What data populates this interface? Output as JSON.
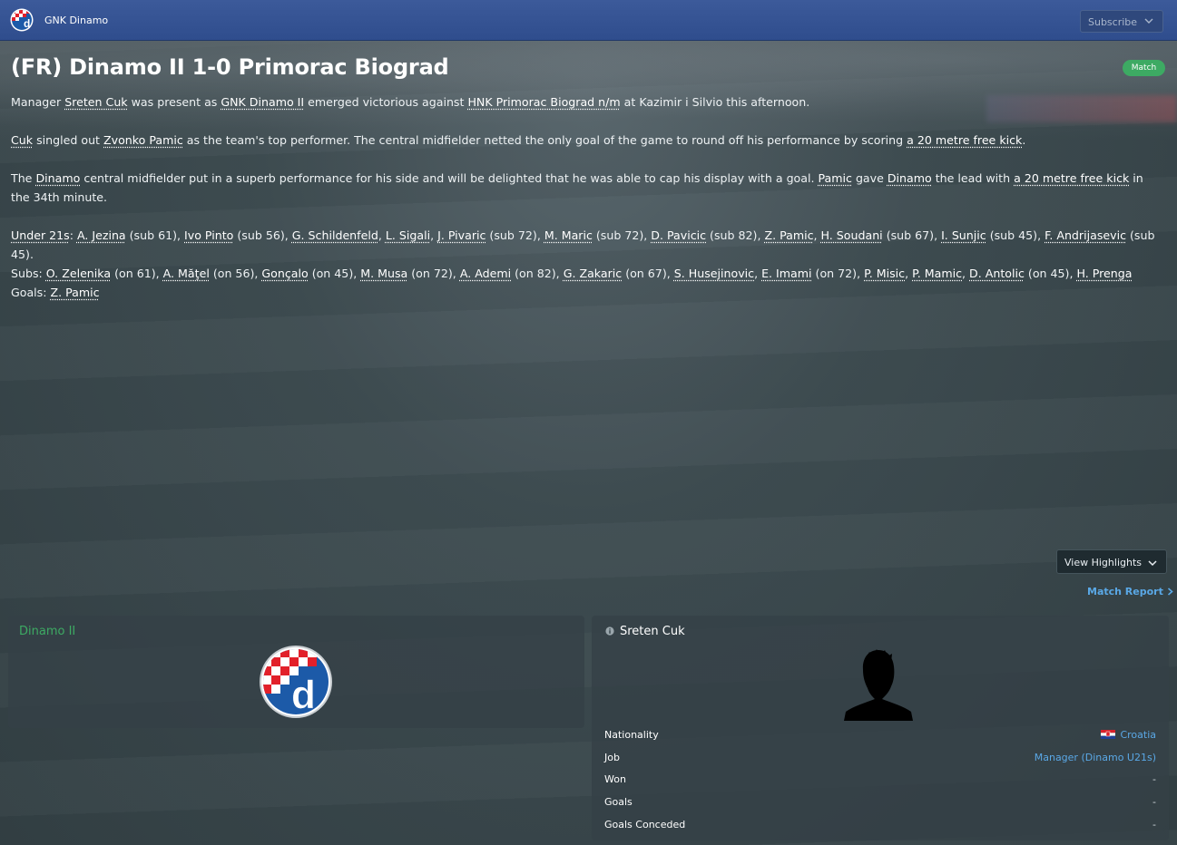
{
  "topbar": {
    "club_name": "GNK Dinamo",
    "subscribe_label": "Subscribe"
  },
  "headline": "(FR) Dinamo II 1-0 Primorac Biograd",
  "badge": "Match",
  "article": {
    "p1": [
      {
        "t": "Manager "
      },
      {
        "t": "Sreten Cuk",
        "link": true
      },
      {
        "t": " was present as "
      },
      {
        "t": "GNK Dinamo II",
        "link": true
      },
      {
        "t": " emerged victorious against "
      },
      {
        "t": "HNK Primorac Biograd n/m",
        "link": true
      },
      {
        "t": " at Kazimir i Silvio this afternoon."
      }
    ],
    "p2": [
      {
        "t": "Cuk",
        "link": true
      },
      {
        "t": " singled out "
      },
      {
        "t": "Zvonko Pamic",
        "link": true
      },
      {
        "t": " as the team's top performer. The central midfielder netted the only goal of the game to round off his performance by scoring "
      },
      {
        "t": "a 20 metre free kick",
        "link": true
      },
      {
        "t": "."
      }
    ],
    "p3": [
      {
        "t": "The "
      },
      {
        "t": "Dinamo",
        "link": true
      },
      {
        "t": " central midfielder put in a superb performance for his side and will be delighted that he was able to cap his display with a goal. "
      },
      {
        "t": "Pamic",
        "link": true
      },
      {
        "t": " gave "
      },
      {
        "t": "Dinamo",
        "link": true
      },
      {
        "t": " the lead with "
      },
      {
        "t": "a 20 metre free kick",
        "link": true
      },
      {
        "t": " in the 34th minute."
      }
    ],
    "under21": [
      {
        "t": "Under 21s",
        "link": true
      },
      {
        "t": ": "
      },
      {
        "t": "A. Jezina",
        "link": true
      },
      {
        "t": " (sub 61), "
      },
      {
        "t": "Ivo Pinto",
        "link": true
      },
      {
        "t": " (sub 56), "
      },
      {
        "t": "G. Schildenfeld",
        "link": true
      },
      {
        "t": ", "
      },
      {
        "t": "L. Sigali",
        "link": true
      },
      {
        "t": ", "
      },
      {
        "t": "J. Pivaric",
        "link": true
      },
      {
        "t": " (sub 72), "
      },
      {
        "t": "M. Maric",
        "link": true
      },
      {
        "t": " (sub 72), "
      },
      {
        "t": "D. Pavicic",
        "link": true
      },
      {
        "t": " (sub 82), "
      },
      {
        "t": "Z. Pamic",
        "link": true
      },
      {
        "t": ", "
      },
      {
        "t": "H. Soudani",
        "link": true
      },
      {
        "t": " (sub 67), "
      },
      {
        "t": "I. Sunjic",
        "link": true
      },
      {
        "t": " (sub 45), "
      },
      {
        "t": "F. Andrijasevic",
        "link": true
      },
      {
        "t": " (sub 45)."
      }
    ],
    "subs": [
      {
        "t": "Subs: "
      },
      {
        "t": "O. Zelenika",
        "link": true
      },
      {
        "t": " (on 61), "
      },
      {
        "t": "A. Măţel",
        "link": true
      },
      {
        "t": " (on 56), "
      },
      {
        "t": "Gonçalo",
        "link": true
      },
      {
        "t": " (on 45), "
      },
      {
        "t": "M. Musa",
        "link": true
      },
      {
        "t": " (on 72), "
      },
      {
        "t": "A. Ademi",
        "link": true
      },
      {
        "t": " (on 82), "
      },
      {
        "t": "G. Zakaric",
        "link": true
      },
      {
        "t": " (on 67), "
      },
      {
        "t": "S. Husejinovic",
        "link": true
      },
      {
        "t": ", "
      },
      {
        "t": "E. Imami",
        "link": true
      },
      {
        "t": " (on 72), "
      },
      {
        "t": "P. Misic",
        "link": true
      },
      {
        "t": ", "
      },
      {
        "t": "P. Mamic",
        "link": true
      },
      {
        "t": ", "
      },
      {
        "t": "D. Antolic",
        "link": true
      },
      {
        "t": " (on 45), "
      },
      {
        "t": "H. Prenga",
        "link": true
      }
    ],
    "goals": [
      {
        "t": "Goals: "
      },
      {
        "t": "Z. Pamic",
        "link": true
      }
    ]
  },
  "highlights": {
    "view_label": "View Highlights",
    "report_label": "Match Report"
  },
  "team_panel": {
    "title": "Dinamo II"
  },
  "manager_panel": {
    "name": "Sreten Cuk",
    "rows": [
      {
        "k": "Nationality",
        "v": "Croatia"
      },
      {
        "k": "Job",
        "v": "Manager (Dinamo U21s)"
      },
      {
        "k": "Won",
        "v": "-"
      },
      {
        "k": "Goals",
        "v": "-"
      },
      {
        "k": "Goals Conceded",
        "v": "-"
      }
    ]
  },
  "colors": {
    "accent_green": "#3daa63",
    "link_blue": "#5aa8e6",
    "topbar_blue": "#2f4d8d",
    "dinamo_red": "#e2202a",
    "dinamo_blue": "#1c5aa8"
  },
  "icons": [
    "dinamo-crest-icon",
    "chevron-down-icon",
    "chevron-right-icon",
    "info-icon",
    "croatia-flag-icon",
    "manager-silhouette-icon"
  ]
}
